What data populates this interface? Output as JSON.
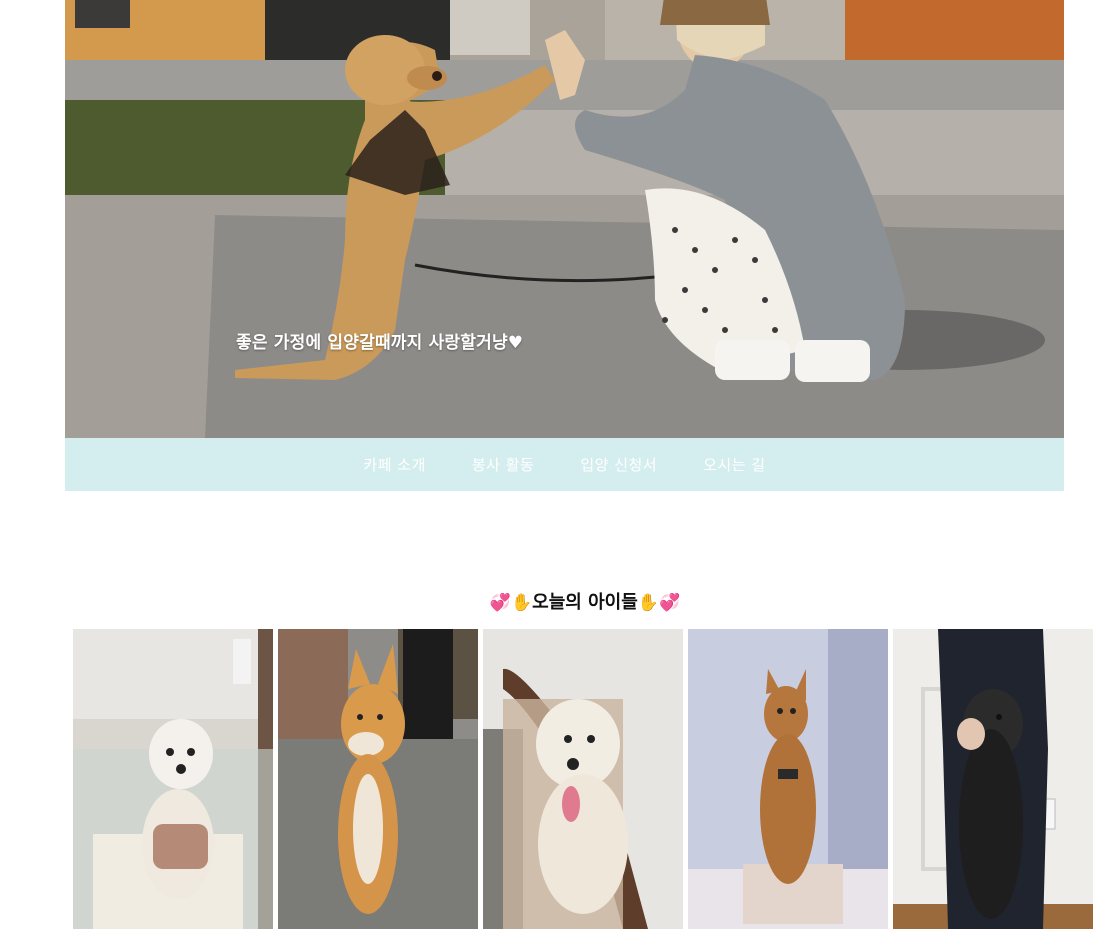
{
  "hero": {
    "caption": "좋은 가정에 입양갈때까지 사랑할거냥",
    "caption_heart": "♥",
    "image": "woman-high-fiving-dog-photo"
  },
  "nav": {
    "items": [
      {
        "label": "카페 소개"
      },
      {
        "label": "봉사 활동"
      },
      {
        "label": "입양 신청서"
      },
      {
        "label": "오시는 길"
      }
    ]
  },
  "section": {
    "title_prefix": "💞✋",
    "title": "오늘의 아이들",
    "title_suffix": "✋💞"
  },
  "gallery": {
    "items": [
      {
        "name": "white-maltese-dog-photo"
      },
      {
        "name": "shiba-inu-dog-photo"
      },
      {
        "name": "white-poodle-dog-photo"
      },
      {
        "name": "brown-mixed-dog-photo"
      },
      {
        "name": "black-poodle-dog-photo"
      }
    ]
  },
  "colors": {
    "nav_bg": "#d4eeef",
    "nav_text": "#ffffff",
    "title_text": "#111111"
  }
}
